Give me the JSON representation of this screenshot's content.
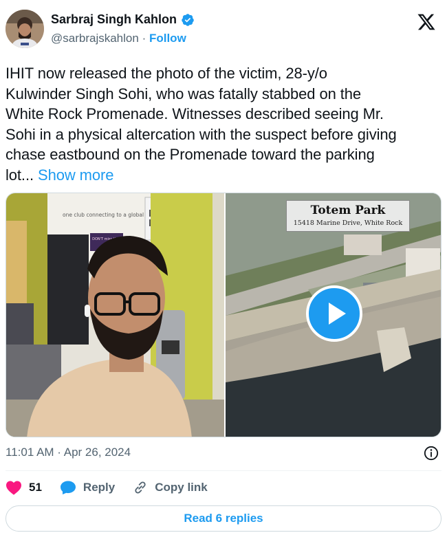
{
  "author": {
    "name": "Sarbraj Singh Kahlon",
    "handle": "@sarbrajskahlon",
    "separator": "·",
    "follow_label": "Follow"
  },
  "tweet": {
    "lines": [
      "IHIT now released the photo of the victim, 28-y/o",
      "Kulwinder Singh Sohi, who was fatally stabbed on the",
      "White Rock Promenade. Witnesses described seeing Mr.",
      "Sohi in a physical altercation with the suspect before giving",
      "chase eastbound on the Promenade toward the parking"
    ],
    "last_line": "lot...",
    "show_more": "Show more"
  },
  "media": {
    "left_photo": {
      "wall_text": "one club connecting to a global",
      "poster_text": "DON'T miss this!"
    },
    "video": {
      "label_title": "Totem Park",
      "label_subtitle": "15418 Marine Drive, White Rock"
    }
  },
  "timestamp": "11:01 AM · Apr 26, 2024",
  "actions": {
    "like_count": "51",
    "reply_label": "Reply",
    "copy_link_label": "Copy link"
  },
  "read_replies_label": "Read 6 replies",
  "colors": {
    "accent": "#1d9bf0",
    "like": "#f91880",
    "muted": "#536471"
  }
}
